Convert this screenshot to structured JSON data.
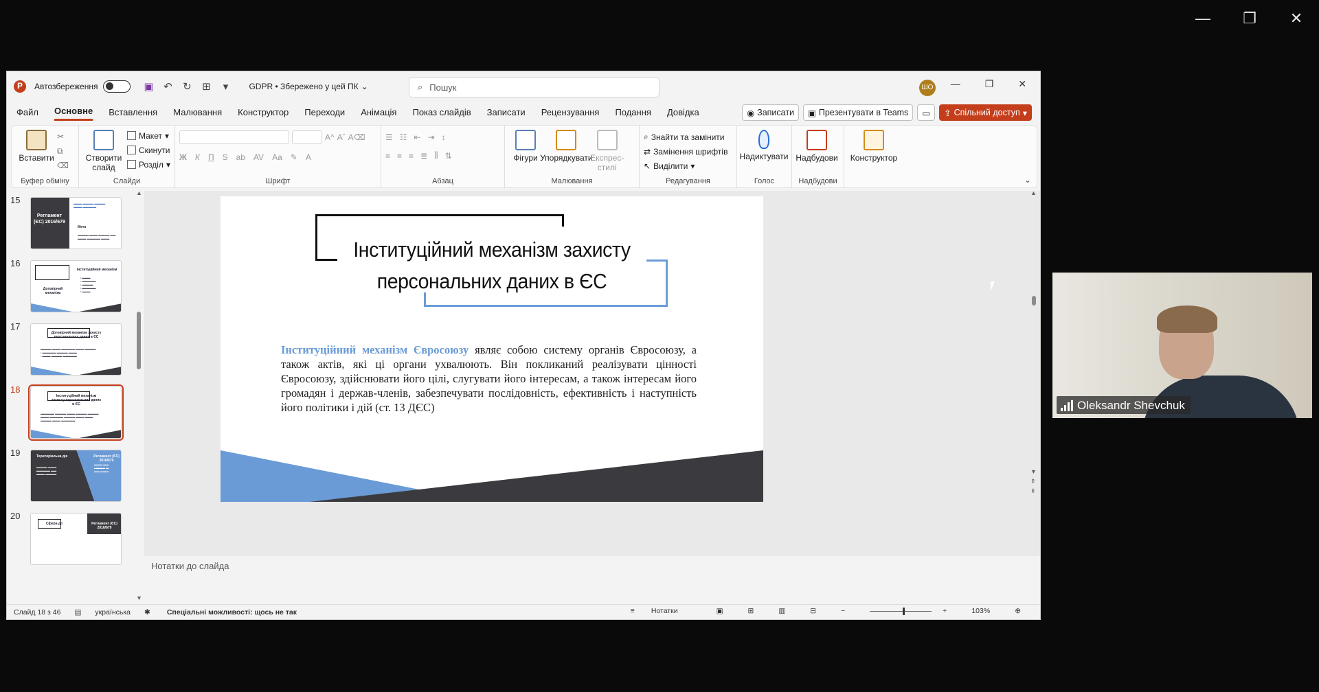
{
  "outer_window": {
    "minimize": "—",
    "restore": "❐",
    "close": "✕"
  },
  "titlebar": {
    "autosave_label": "Автозбереження",
    "doc_title": "GDPR • Збережено у цей ПК",
    "search_placeholder": "Пошук",
    "avatar_initials": "ШО"
  },
  "tabs": [
    "Файл",
    "Основне",
    "Вставлення",
    "Малювання",
    "Конструктор",
    "Переходи",
    "Анімація",
    "Показ слайдів",
    "Записати",
    "Рецензування",
    "Подання",
    "Довідка"
  ],
  "active_tab": "Основне",
  "tab_actions": {
    "record": "Записати",
    "present_teams": "Презентувати в Teams",
    "share": "Спільний доступ"
  },
  "ribbon": {
    "clipboard": {
      "paste": "Вставити",
      "label": "Буфер обміну"
    },
    "slides": {
      "new_slide": "Створити слайд",
      "layout": "Макет",
      "reset": "Скинути",
      "section": "Розділ",
      "label": "Слайди"
    },
    "font": {
      "label": "Шрифт"
    },
    "paragraph": {
      "label": "Абзац"
    },
    "drawing": {
      "shapes": "Фігури",
      "arrange": "Упорядкувати",
      "quick_styles": "Експрес-стилі",
      "label": "Малювання"
    },
    "editing": {
      "find_replace": "Знайти та замінити",
      "replace_fonts": "Замінення шрифтів",
      "select": "Виділити",
      "label": "Редагування"
    },
    "voice": {
      "dictate": "Надиктувати",
      "label": "Голос"
    },
    "addins": {
      "addins": "Надбудови",
      "label": "Надбудови"
    },
    "designer": {
      "designer": "Конструктор"
    }
  },
  "thumbnails": [
    {
      "num": "15",
      "title": "Регламент (ЄС) 2016/679",
      "subtitle": "Мета"
    },
    {
      "num": "16",
      "title": "Договірний механізм",
      "subtitle": "Інституційний механізм"
    },
    {
      "num": "17",
      "title": "Договірний механізм захисту персональних даних в ЄС",
      "subtitle": ""
    },
    {
      "num": "18",
      "title": "Інституційний механізм захисту персональних даних в ЄС",
      "subtitle": ""
    },
    {
      "num": "19",
      "title": "Територіальна дія",
      "subtitle": "Регламент (ЄС) 2016/679"
    },
    {
      "num": "20",
      "title": "Сфера дії",
      "subtitle": "Регламент (ЄС) 2016/679"
    }
  ],
  "active_slide": "18",
  "slide": {
    "title_line1": "Інституційний механізм захисту",
    "title_line2": "персональних даних в ЄС",
    "body_highlight": "Інституційний механізм Євросоюзу",
    "body_text": " являє собою систему органів Євросоюзу, а також актів, які ці органи ухвалюють. Він покликаний реалізувати цінності Євросоюзу, здійснювати його цілі, слугувати його інтересам, а також інтересам його громадян і держав-членів, забезпечувати послідовність, ефективність і наступність його політики і дій (ст. 13 ДЄС)"
  },
  "notes_placeholder": "Нотатки до слайда",
  "statusbar": {
    "slide_counter": "Слайд 18 з 46",
    "language": "українська",
    "accessibility": "Спеціальні можливості: щось не так",
    "notes": "Нотатки",
    "zoom": "103%"
  },
  "video": {
    "participant": "Oleksandr Shevchuk"
  },
  "colors": {
    "accent": "#c43e1c",
    "slide_blue": "#6a9bd6",
    "slide_dark": "#3b3b3f"
  }
}
